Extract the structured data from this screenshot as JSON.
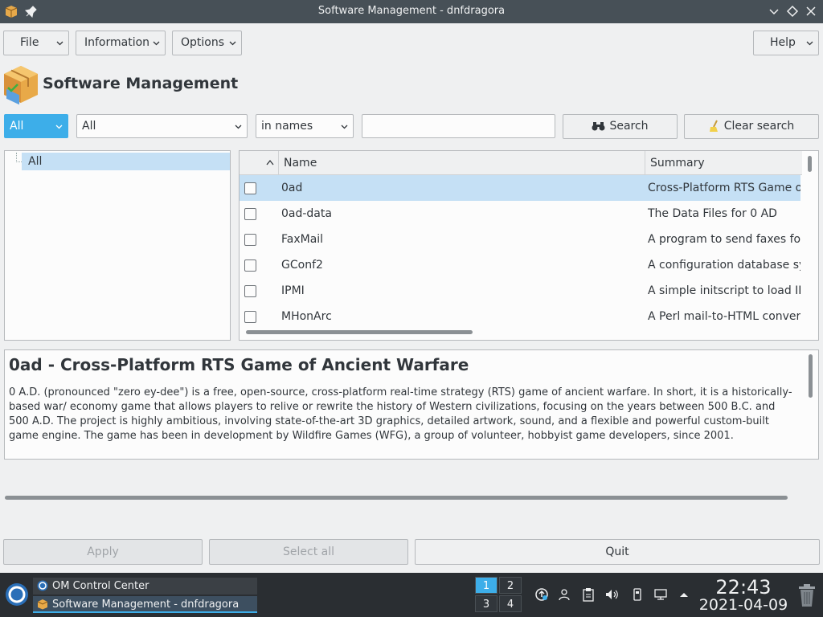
{
  "window": {
    "title": "Software Management - dnfdragora"
  },
  "menubar": {
    "file": "File",
    "information": "Information",
    "options": "Options",
    "help": "Help"
  },
  "header": {
    "title": "Software Management"
  },
  "filters": {
    "group_filter": "All",
    "category_filter": "All",
    "search_field": "in names",
    "search_value": "",
    "search_button": "Search",
    "clear_button": "Clear search"
  },
  "tree": {
    "items": [
      {
        "label": "All",
        "selected": true
      }
    ]
  },
  "packages": {
    "columns": [
      "Name",
      "Summary"
    ],
    "rows": [
      {
        "name": "0ad",
        "summary": "Cross-Platform RTS Game of An",
        "checked": false,
        "selected": true
      },
      {
        "name": "0ad-data",
        "summary": "The Data Files for 0 AD",
        "checked": false,
        "selected": false
      },
      {
        "name": "FaxMail",
        "summary": "A program to send faxes for fre",
        "checked": false,
        "selected": false
      },
      {
        "name": "GConf2",
        "summary": "A configuration database syster",
        "checked": false,
        "selected": false
      },
      {
        "name": "IPMI",
        "summary": "A simple initscript to load IPMI",
        "checked": false,
        "selected": false
      },
      {
        "name": "MHonArc",
        "summary": "A Perl mail-to-HTML converter",
        "checked": false,
        "selected": false
      }
    ]
  },
  "details": {
    "title": "0ad - Cross-Platform RTS Game of Ancient Warfare",
    "description": "0 A.D. (pronounced \"zero ey-dee\") is a free, open-source, cross-platform real-time strategy (RTS) game of ancient warfare. In short, it is a historically-based war/ economy game that allows players to relive or rewrite the history of Western civilizations, focusing on the years between 500 B.C. and 500 A.D. The project is highly ambitious, involving state-of-the-art 3D graphics, detailed artwork, sound, and a flexible and powerful custom-built game engine. The game has been in development by Wildfire Games (WFG), a group of volunteer, hobbyist game developers, since 2001."
  },
  "actions": {
    "apply": "Apply",
    "select_all": "Select all",
    "quit": "Quit"
  },
  "taskbar": {
    "tasks": [
      {
        "label": "OM Control Center",
        "active": false
      },
      {
        "label": "Software Management - dnfdragora",
        "active": true
      }
    ],
    "desktops": [
      "1",
      "2",
      "3",
      "4"
    ],
    "active_desktop": "1",
    "clock_time": "22:43",
    "clock_date": "2021-04-09"
  },
  "colors": {
    "accent": "#3daee9",
    "selection": "#c5e0f5",
    "titlebar": "#475057",
    "taskbar": "#2a2e32"
  },
  "icons": {
    "app": "package-box-icon",
    "pin": "pin-icon",
    "search": "binoculars-icon",
    "clear": "broom-icon"
  }
}
